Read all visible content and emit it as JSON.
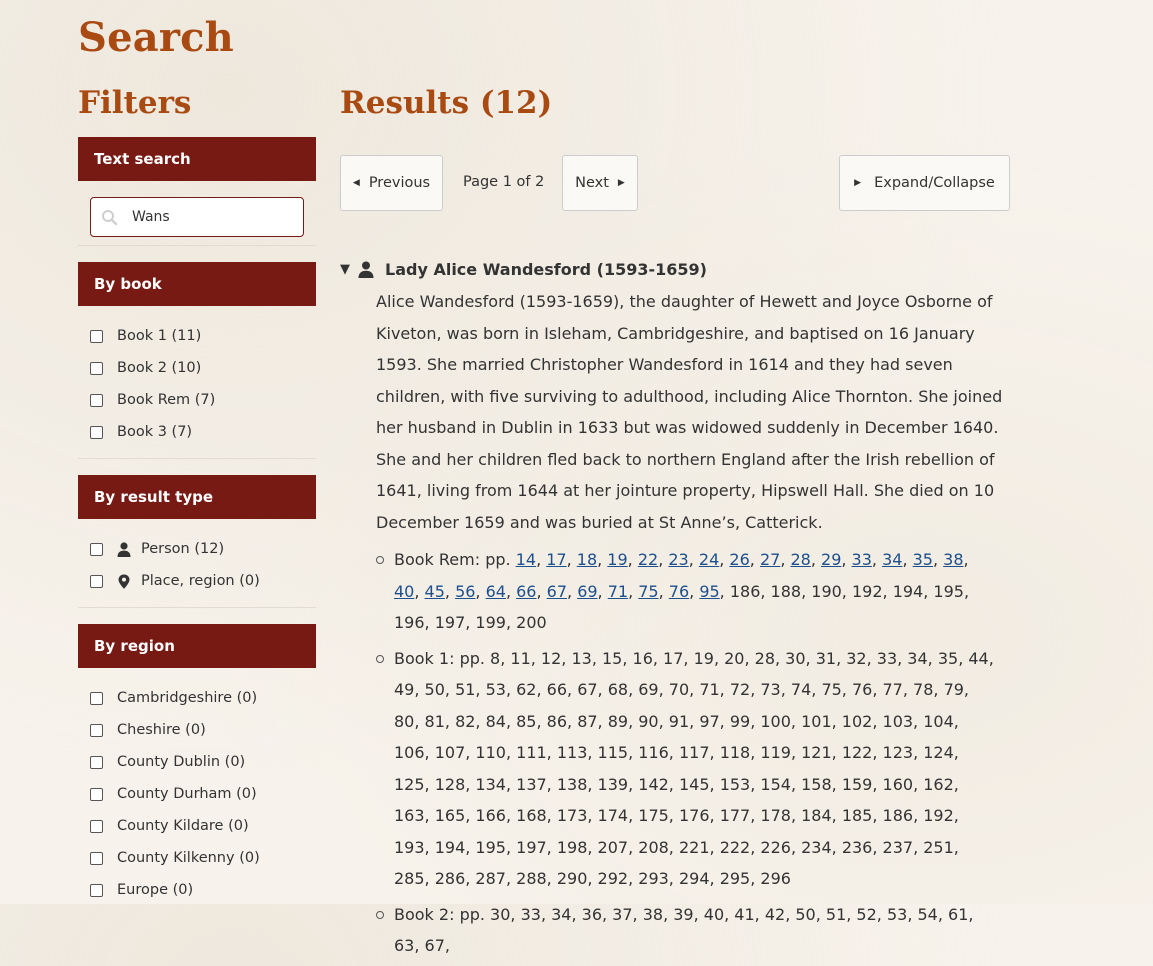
{
  "page": {
    "title": "Search"
  },
  "filters": {
    "heading": "Filters",
    "text_search": {
      "label": "Text search",
      "value": "Wans"
    },
    "by_book": {
      "label": "By book",
      "items": [
        "Book 1 (11)",
        "Book 2 (10)",
        "Book Rem (7)",
        "Book 3 (7)"
      ]
    },
    "by_result_type": {
      "label": "By result type",
      "items": [
        {
          "label": "Person (12)",
          "icon": "person-icon"
        },
        {
          "label": "Place, region (0)",
          "icon": "location-pin-icon"
        }
      ]
    },
    "by_region": {
      "label": "By region",
      "items": [
        "Cambridgeshire (0)",
        "Cheshire (0)",
        "County Dublin (0)",
        "County Durham (0)",
        "County Kildare (0)",
        "County Kilkenny (0)",
        "Europe (0)"
      ]
    }
  },
  "results": {
    "heading": "Results (12)",
    "toolbar": {
      "previous": "Previous",
      "page_info": "Page 1 of 2",
      "next": "Next",
      "expand_collapse": "Expand/Collapse"
    },
    "entry": {
      "title": "Lady Alice Wandesford (1593-1659)",
      "description": "Alice Wandesford (1593-1659), the daughter of Hewett and Joyce Osborne of Kiveton, was born in Isleham, Cambridgeshire, and baptised on 16 January 1593. She married Christopher Wandesford in 1614 and they had seven children, with five surviving to adulthood, including Alice Thornton. She joined her husband in Dublin in 1633 but was widowed suddenly in December 1640. She and her children fled back to northern England after the Irish rebellion of 1641, living from 1644 at her jointure property, Hipswell Hall. She died on 10 December 1659 and was buried at St Anne’s, Catterick.",
      "refs": [
        {
          "prefix": "Book Rem: pp. ",
          "linked": [
            "14",
            "17",
            "18",
            "19",
            "22",
            "23",
            "24",
            "26",
            "27",
            "28",
            "29",
            "33",
            "34",
            "35",
            "38",
            "40",
            "45",
            "56",
            "64",
            "66",
            "67",
            "69",
            "71",
            "75",
            "76",
            "95"
          ],
          "plain": "186, 188, 190, 192, 194, 195, 196, 197, 199, 200"
        },
        {
          "prefix": "Book 1: pp. ",
          "linked": [],
          "plain": "8, 11, 12, 13, 15, 16, 17, 19, 20, 28, 30, 31, 32, 33, 34, 35, 44, 49, 50, 51, 53, 62, 66, 67, 68, 69, 70, 71, 72, 73, 74, 75, 76, 77, 78, 79, 80, 81, 82, 84, 85, 86, 87, 89, 90, 91, 97, 99, 100, 101, 102, 103, 104, 106, 107, 110, 111, 113, 115, 116, 117, 118, 119, 121, 122, 123, 124, 125, 128, 134, 137, 138, 139, 142, 145, 153, 154, 158, 159, 160, 162, 163, 165, 166, 168, 173, 174, 175, 176, 177, 178, 184, 185, 186, 192, 193, 194, 195, 197, 198, 207, 208, 221, 222, 226, 234, 236, 237, 251, 285, 286, 287, 288, 290, 292, 293, 294, 295, 296"
        },
        {
          "prefix": "Book 2: pp. ",
          "linked": [],
          "plain": "30, 33, 34, 36, 37, 38, 39, 40, 41, 42, 50, 51, 52, 53, 54, 61, 63, 67,"
        }
      ]
    }
  }
}
